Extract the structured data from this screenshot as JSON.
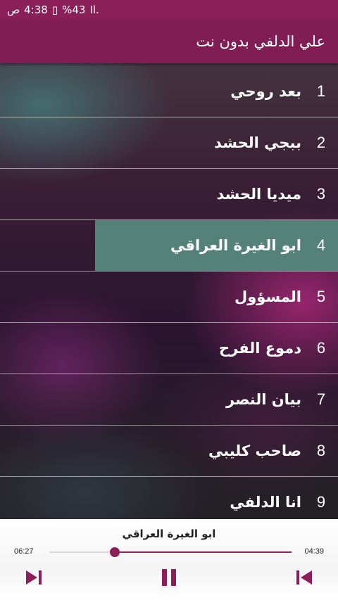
{
  "status": {
    "time": "4:38",
    "ampm": "ص",
    "battery": "%43",
    "signal": "Il."
  },
  "appbar": {
    "title": "علي الدلفي بدون نت"
  },
  "tracks": [
    {
      "num": "1",
      "name": "بعد روحي"
    },
    {
      "num": "2",
      "name": "ببجي الحشد"
    },
    {
      "num": "3",
      "name": "ميديا الحشد"
    },
    {
      "num": "4",
      "name": "ابو الغيرة العراقي"
    },
    {
      "num": "5",
      "name": "المسؤول"
    },
    {
      "num": "6",
      "name": "دموع الفرح"
    },
    {
      "num": "7",
      "name": "بيان النصر"
    },
    {
      "num": "8",
      "name": "صاحب كليبي"
    },
    {
      "num": "9",
      "name": "انا الدلفي"
    }
  ],
  "active_index": 3,
  "player": {
    "track": "ابو الغيرة العراقي",
    "elapsed": "06:27",
    "duration": "04:39",
    "progress": 0.73
  },
  "colors": {
    "accent": "#8a1f5a",
    "appbar": "#7f1d54",
    "highlight": "#548279"
  },
  "icons": {
    "next": "skip-next-icon",
    "pause": "pause-icon",
    "prev": "skip-prev-icon"
  }
}
